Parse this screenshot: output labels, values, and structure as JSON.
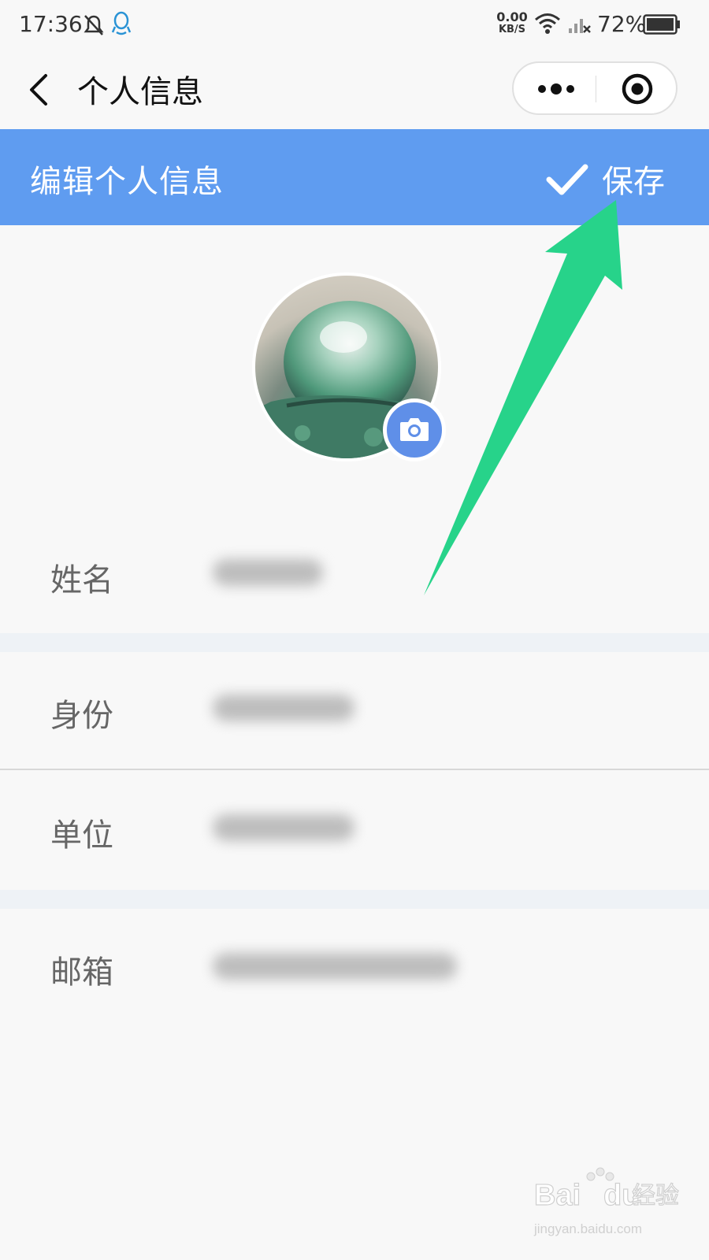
{
  "status_bar": {
    "time": "17:36",
    "net_speed_value": "0.00",
    "net_speed_unit": "KB/S",
    "battery": "72%",
    "icons": [
      "bell-off-icon",
      "qq-icon",
      "wifi-icon",
      "signal-icon",
      "battery-icon"
    ]
  },
  "nav": {
    "title": "个人信息",
    "back_icon": "chevron-left-icon",
    "more_icon": "more-dots-icon",
    "target_icon": "target-icon"
  },
  "header": {
    "title": "编辑个人信息",
    "save_label": "保存",
    "save_icon": "check-icon",
    "color": "#5f9cf0"
  },
  "avatar": {
    "camera_icon": "camera-icon"
  },
  "form": {
    "fields": [
      {
        "label": "姓名"
      },
      {
        "label": "身份"
      },
      {
        "label": "单位"
      },
      {
        "label": "邮箱"
      }
    ]
  },
  "annotation": {
    "arrow_color": "#27d38a"
  },
  "watermark": {
    "brand": "Bai",
    "brand2": "du",
    "product": "经验",
    "url": "jingyan.baidu.com"
  }
}
